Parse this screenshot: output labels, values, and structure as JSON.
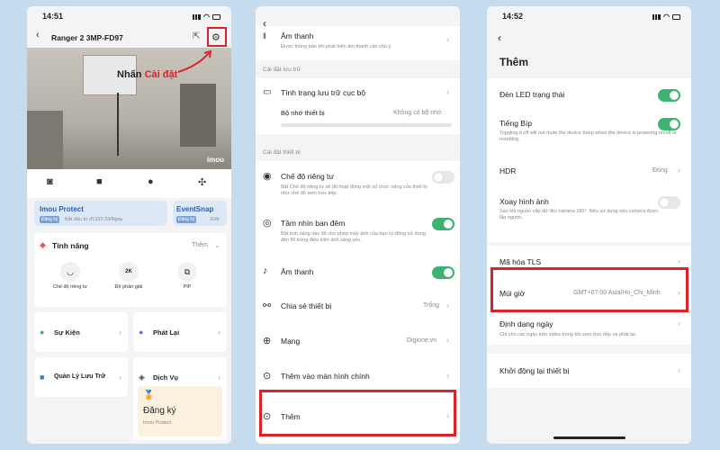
{
  "colors": {
    "accent_green": "#3cb371",
    "highlight_red": "#d9232b",
    "background": "#c5dcef"
  },
  "screen1": {
    "time": "14:51",
    "device_title": "Ranger 2 3MP-FD97",
    "callout": {
      "prefix": "Nhấn",
      "highlight": "Cài đặt"
    },
    "video_logo": "imou",
    "protect": {
      "title": "Imou Protect",
      "badge": "Đăng ký",
      "desc": "Bắt đầu từ đ1333.33/Ngày"
    },
    "eventsnap": {
      "title": "EventSnap",
      "badge": "Đăng ký",
      "badge2": "Edit"
    },
    "features": {
      "title": "Tính năng",
      "more": "Thêm",
      "items": [
        {
          "icon": "eye-off-icon",
          "glyph": "᷼",
          "label": "Chế độ riêng tư"
        },
        {
          "icon": "resolution-icon",
          "glyph": "2K",
          "label": "Độ phân giải"
        },
        {
          "icon": "pip-icon",
          "glyph": "⧉",
          "label": "PIP"
        }
      ]
    },
    "tiles": [
      {
        "icon": "event-icon",
        "label": "Sự Kiện"
      },
      {
        "icon": "playback-icon",
        "label": "Phát Lại"
      },
      {
        "icon": "storage-icon",
        "label": "Quản Lý Lưu Trữ"
      },
      {
        "icon": "service-icon",
        "label": "Dịch Vụ"
      }
    ],
    "service_card": {
      "title": "Đăng ký",
      "sub": "Imou Protect"
    }
  },
  "screen2": {
    "top_item": {
      "title": "Âm thanh",
      "desc": "Được thông báo khi phát hiện âm thanh cần chú ý."
    },
    "storage_section": "Cài đặt lưu trữ",
    "storage": {
      "title": "Tình trạng lưu trữ cục bộ",
      "sub_label": "Bộ nhớ thiết bị",
      "sub_value": "Không có bộ nhớ"
    },
    "device_section": "Cài đặt thiết bị",
    "rows": [
      {
        "icon": "eye-icon",
        "title": "Chế độ riêng tư",
        "desc": "Bật Chế độ riêng tư sẽ tắt hoạt động một số chức năng của thiết bị như chế độ xem trực tiếp."
      },
      {
        "icon": "night-vision-icon",
        "title": "Tầm nhìn ban đêm",
        "desc": "Bật tính năng này để cho phép máy ảnh của bạn tự động sử dụng đèn IR trong điều kiện ánh sáng yếu."
      },
      {
        "icon": "mic-icon",
        "title": "Âm thanh"
      },
      {
        "icon": "share-icon",
        "title": "Chia sẻ thiết bị",
        "value": "Trống"
      },
      {
        "icon": "globe-icon",
        "title": "Mạng",
        "value": "Digione.vn"
      },
      {
        "icon": "home-screen-icon",
        "title": "Thêm vào màn hình chính"
      },
      {
        "icon": "more-icon",
        "title": "Thêm"
      }
    ]
  },
  "screen3": {
    "time": "14:52",
    "title": "Thêm",
    "items": [
      {
        "title": "Đèn LED trạng thái"
      },
      {
        "title": "Tiếng Bíp",
        "desc": "Toggling it off will not mute the device beep when the device is powering on/off or resetting."
      },
      {
        "title": "HDR",
        "value": "Đóng"
      },
      {
        "title": "Xoay hình ảnh",
        "desc": "Sau khi nguồn cấp dữ liệu camera 180°. Nếu sử dụng nếu camera được lắp ngược."
      },
      {
        "title": "Mã hóa TLS"
      },
      {
        "title": "Múi giờ",
        "value": "GMT+07:00 Asia/Ho_Chi_Minh"
      },
      {
        "title": "Định dạng ngày",
        "desc": "Chỉ cho các ngày trên video trong khi xem trực tiếp và phát lại."
      },
      {
        "title": "Khởi động lại thiết bị"
      }
    ]
  }
}
